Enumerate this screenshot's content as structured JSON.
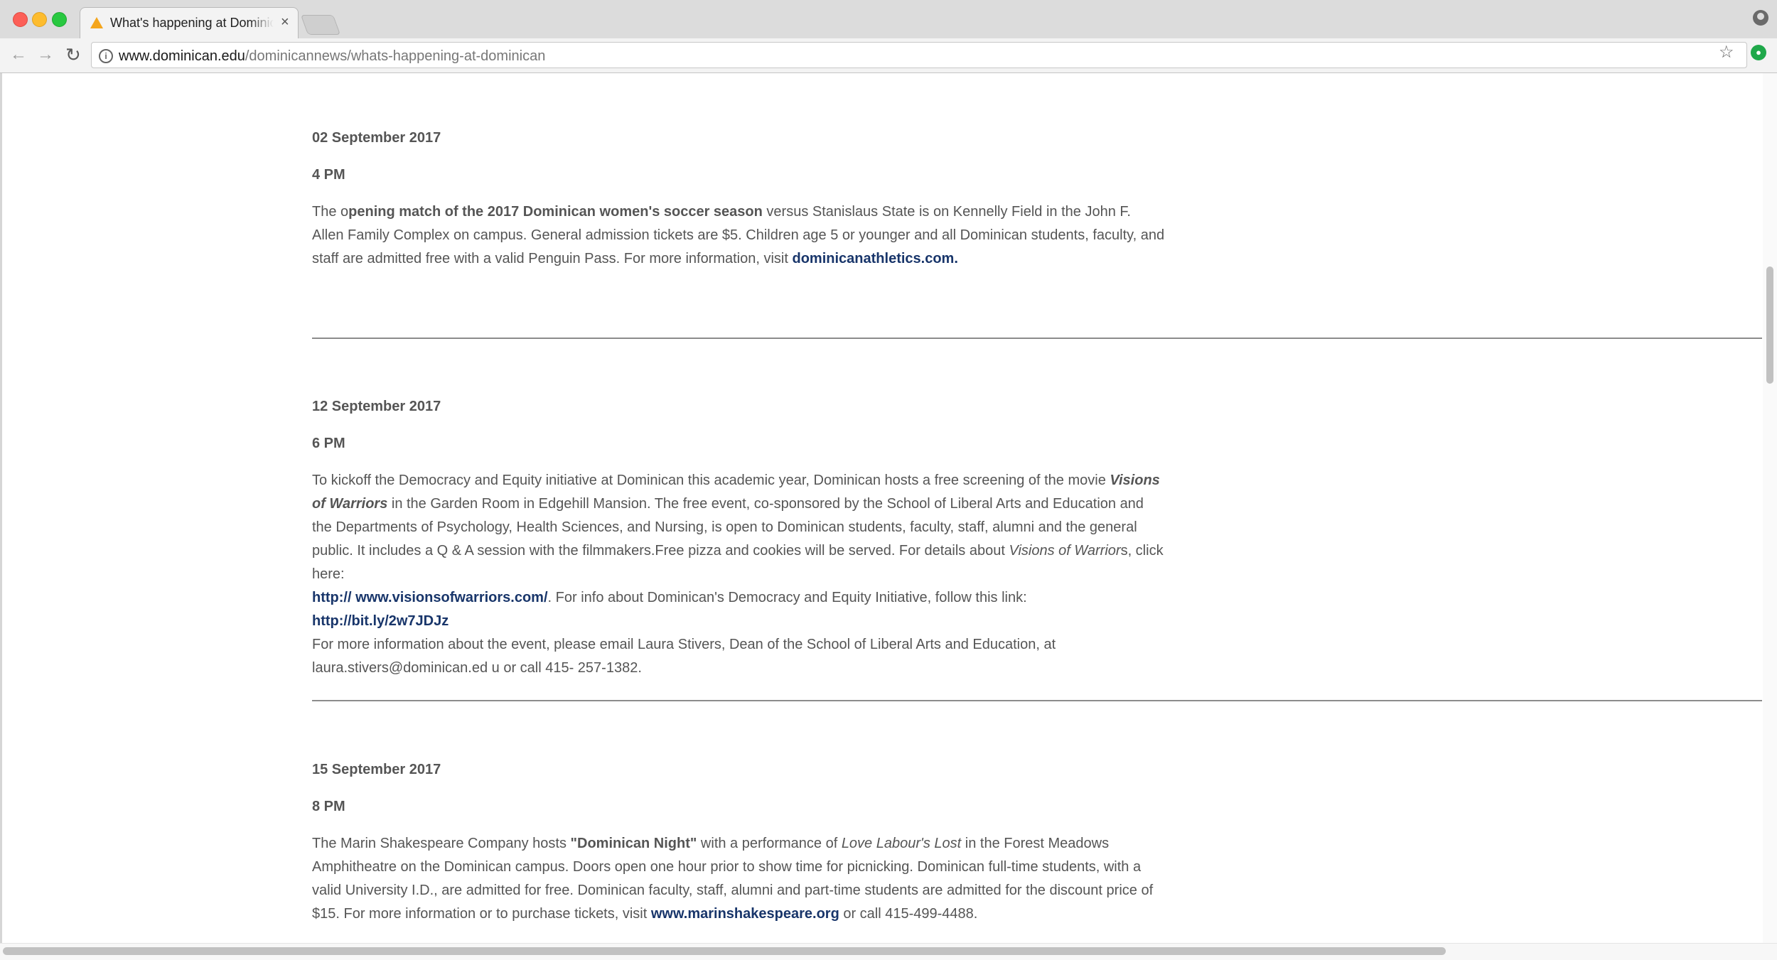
{
  "browser": {
    "tab_title": "What's happening at Dominican",
    "tab_close": "×",
    "url_host": "www.dominican.edu",
    "url_path": "/dominicannews/whats-happening-at-dominican",
    "icons": [
      "back-arrow-icon",
      "forward-arrow-icon",
      "reload-icon",
      "info-icon",
      "star-icon",
      "profile-icon",
      "extension-icon"
    ]
  },
  "events": [
    {
      "date": "02 September 2017",
      "time": "4 PM",
      "p1": "The o",
      "bold1": "pening match of the 2017 Dominican women's soccer season",
      "p2": " versus Stanislaus State  is on Kennelly Field in the John F. Allen Family Complex on campus. General admission tickets are $5. Children age 5 or younger and all Dominican students, faculty, and staff are admitted free with a valid Penguin Pass. For more information, visit ",
      "link": "dominicanathletics.com."
    },
    {
      "date": "12 September 2017",
      "time": "6 PM",
      "p1": "To kickoff the Democracy and Equity initiative at Dominican this academic year, Dominican hosts a free screening of the movie ",
      "bolditalic1": "Visions of Warriors ",
      "p2": "in the Garden Room in Edgehill Mansion. The free event, co-sponsored by the School of Liberal Arts and Education and the Departments of Psychology, Health Sciences, and Nursing, is open to Dominican students, faculty, staff, alumni and the general public. It includes a Q & A session with the filmmakers.Free pizza and cookies will be served. For details about ",
      "italic1": "Visions of Warrior",
      "p3": "s, click here: ",
      "link1": "http:// www.visionsofwarriors.com/",
      "p4": ". For info about Dominican's Democracy and Equity Initiative, follow this link: ",
      "link2": "http://bit.ly/2w7JDJz",
      "p5": "For more information about the event, please email Laura Stivers, Dean of the School of Liberal Arts and Education, at laura.stivers@dominican.ed u or call 415- 257-1382."
    },
    {
      "date": "15 September 2017",
      "time": "8 PM",
      "p1": "The Marin Shakespeare Company hosts ",
      "bold1": "\"Dominican Night\"",
      "p2": " with a performance of ",
      "italic1": "Love Labour's Lost",
      "p3": " in the Forest Meadows Amphitheatre on the Dominican campus. Doors open one hour prior to show time for picnicking. Dominican full-time students, with a valid University I.D., are admitted for free. Dominican faculty, staff, alumni and part-time students are admitted for the discount price of $15. For more information or to purchase tickets, visit ",
      "link": "www.marinshakespeare.org",
      "p4": " or call 415-499-4488."
    }
  ]
}
